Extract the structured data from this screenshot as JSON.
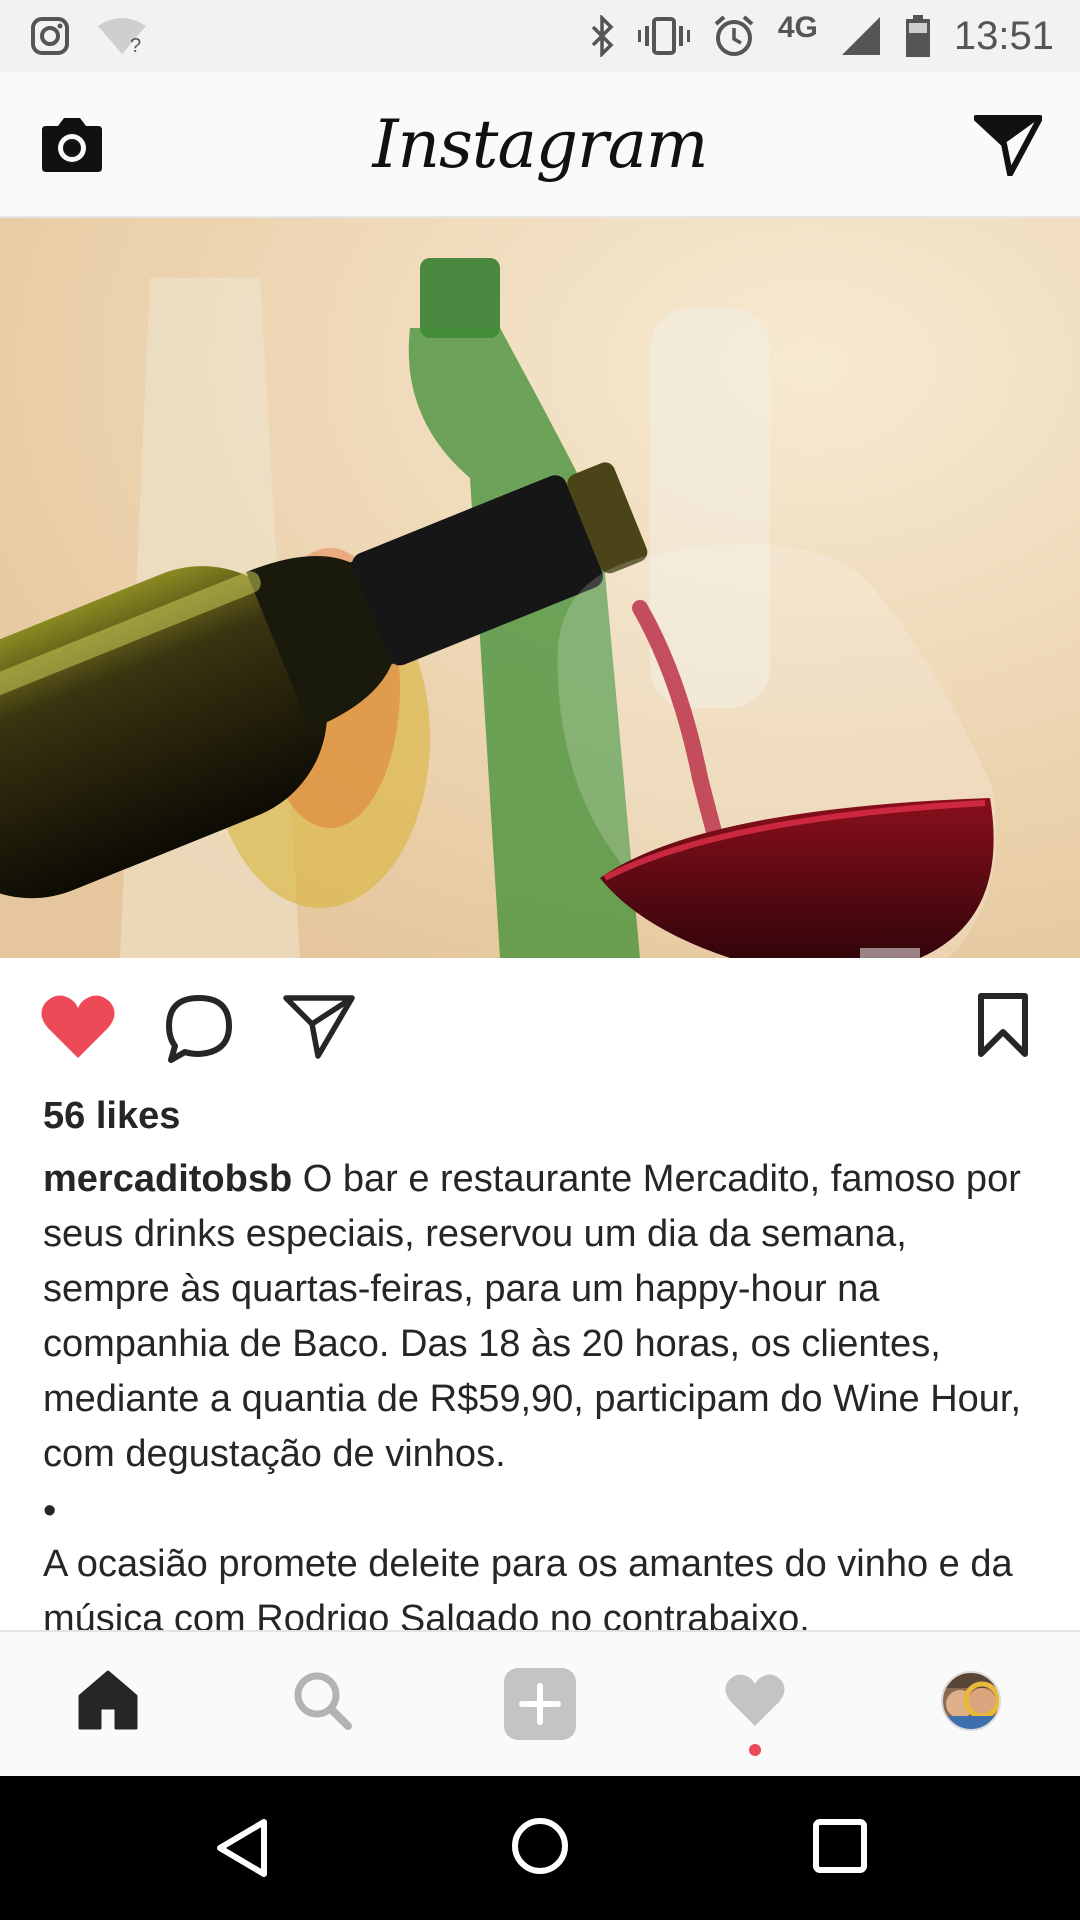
{
  "status_bar": {
    "time": "13:51",
    "network": "4G",
    "icons": [
      "instagram-icon",
      "wifi-question-icon",
      "bluetooth-icon",
      "vibrate-icon",
      "alarm-icon",
      "signal-icon",
      "battery-icon"
    ]
  },
  "header": {
    "title": "Instagram",
    "left_icon": "camera-icon",
    "right_icon": "direct-send-icon"
  },
  "post": {
    "image_description_icon": "wine-photo",
    "liked": true,
    "likes_text": "56 likes",
    "username": "mercaditobsb",
    "caption": "O bar e restaurante Mercadito, famoso por seus drinks especiais, reservou um dia da semana, sempre às quartas-feiras, para um happy-hour na companhia de Baco. Das 18 às 20 horas, os clientes, mediante a quantia de R$59,90, participam do Wine Hour, com degustação de vinhos.",
    "separator": "•",
    "caption_continued": "A ocasião promete deleite para os amantes do vinho e da música com Rodrigo Salgado no contrabaixo.",
    "like_color": "#ed4956"
  },
  "bottom_nav": {
    "items": [
      "home-icon",
      "search-icon",
      "add-post-icon",
      "activity-heart-icon",
      "profile-avatar"
    ],
    "notification_color": "#ed4956"
  },
  "system_nav": [
    "back-button",
    "home-button",
    "recents-button"
  ]
}
